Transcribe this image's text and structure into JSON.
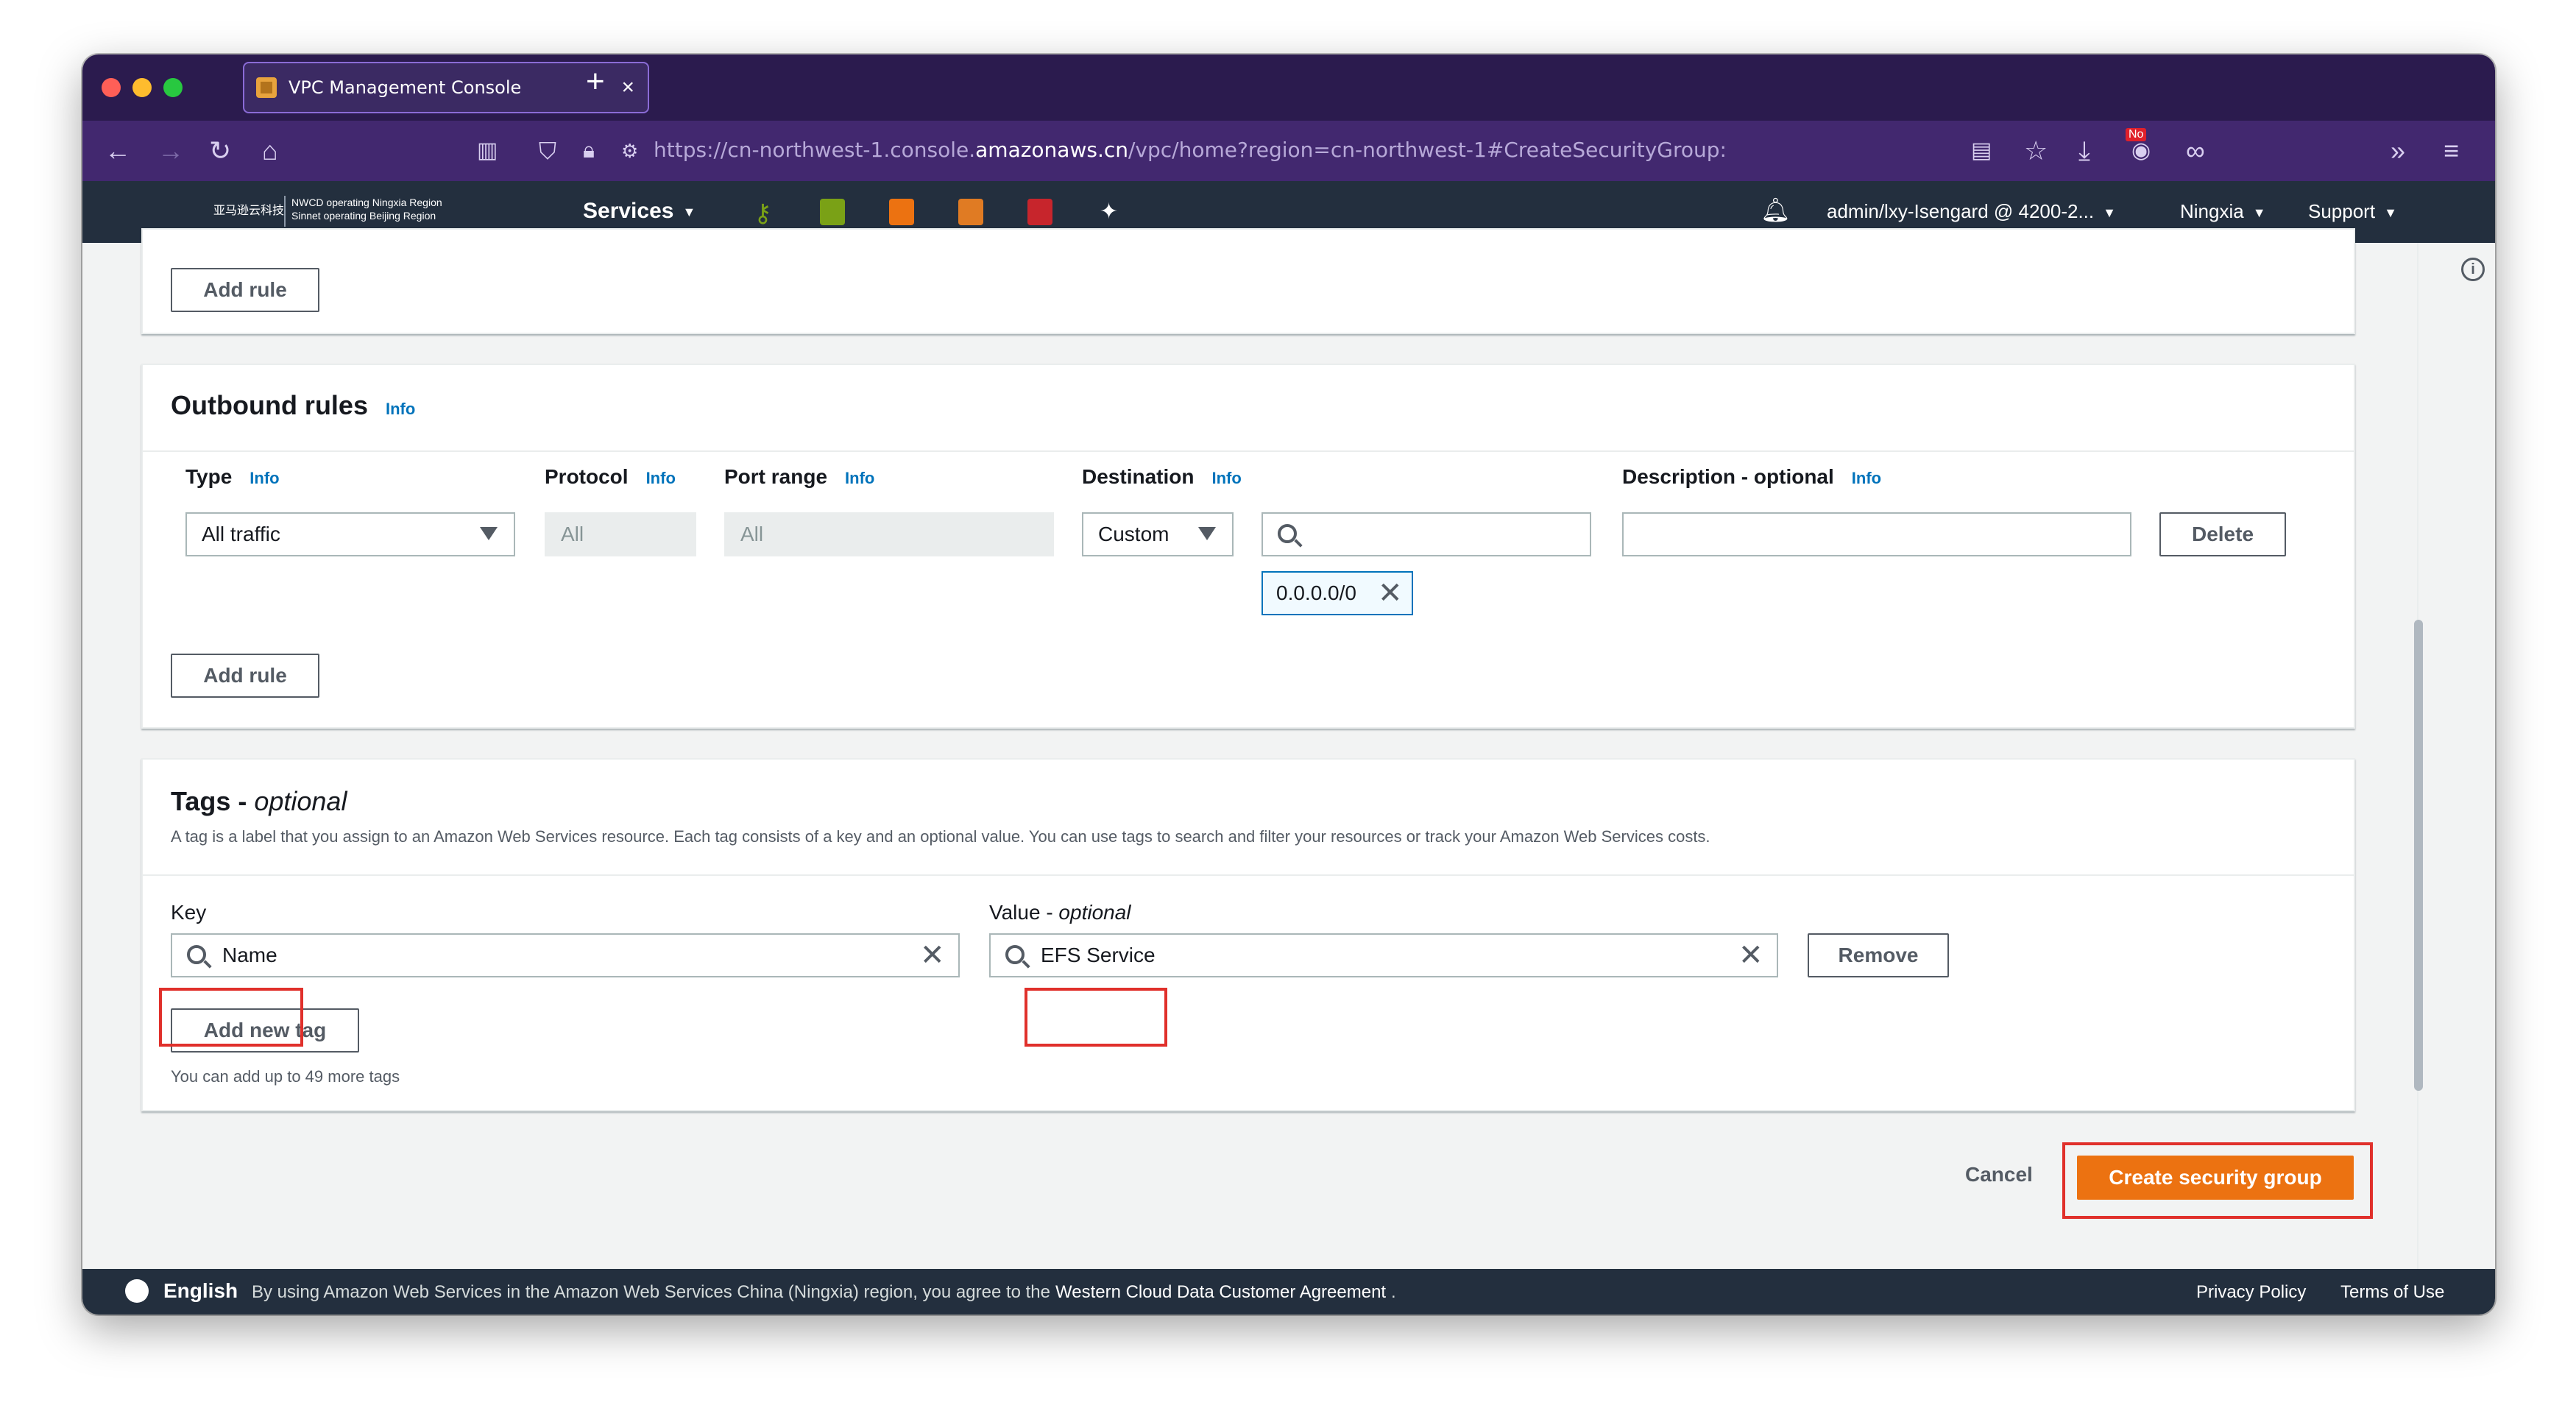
{
  "browser": {
    "tab_title": "VPC Management Console",
    "tab_close": "×",
    "new_tab": "+",
    "url_prefix": "https://cn-northwest-1.console.",
    "url_domain": "amazonaws.cn",
    "url_suffix": "/vpc/home?region=cn-northwest-1#CreateSecurityGroup:",
    "badge": "No"
  },
  "aws_header": {
    "logo_cn": "亚马逊云科技",
    "logo_line1": "NWCD operating Ningxia Region",
    "logo_line2": "Sinnet operating Beijing Region",
    "services": "Services",
    "account": "admin/lxy-Isengard @ 4200-2...",
    "region": "Ningxia",
    "support": "Support"
  },
  "inbound": {
    "add_rule": "Add rule"
  },
  "outbound": {
    "title": "Outbound rules",
    "info": "Info",
    "columns": {
      "type": "Type",
      "protocol": "Protocol",
      "port_range": "Port range",
      "destination": "Destination",
      "description": "Description - optional"
    },
    "row": {
      "type": "All traffic",
      "protocol": "All",
      "port_range": "All",
      "destination_mode": "Custom",
      "destination_search": "",
      "cidr_token": "0.0.0.0/0",
      "description": "",
      "delete": "Delete"
    },
    "add_rule": "Add rule"
  },
  "tags": {
    "title": "Tags - ",
    "title_optional": "optional",
    "description": "A tag is a label that you assign to an Amazon Web Services resource. Each tag consists of a key and an optional value. You can use tags to search and filter your resources or track your Amazon Web Services costs.",
    "key_label": "Key",
    "value_label": "Value - ",
    "value_label_optional": "optional",
    "key": "Name",
    "value": "EFS Service",
    "remove": "Remove",
    "add_new_tag": "Add new tag",
    "limit_note": "You can add up to 49 more tags"
  },
  "actions": {
    "cancel": "Cancel",
    "create": "Create security group"
  },
  "footer": {
    "language": "English",
    "agreement_text": "By using Amazon Web Services in the Amazon Web Services China (Ningxia) region, you agree to the",
    "agreement_link": "Western Cloud Data Customer Agreement",
    "period": ".",
    "privacy": "Privacy Policy",
    "terms": "Terms of Use"
  },
  "colors": {
    "primary": "#ec7211",
    "highlight": "#e0302b",
    "link": "#0073bb",
    "header": "#232f3e",
    "browser_chrome": "#42286f"
  }
}
